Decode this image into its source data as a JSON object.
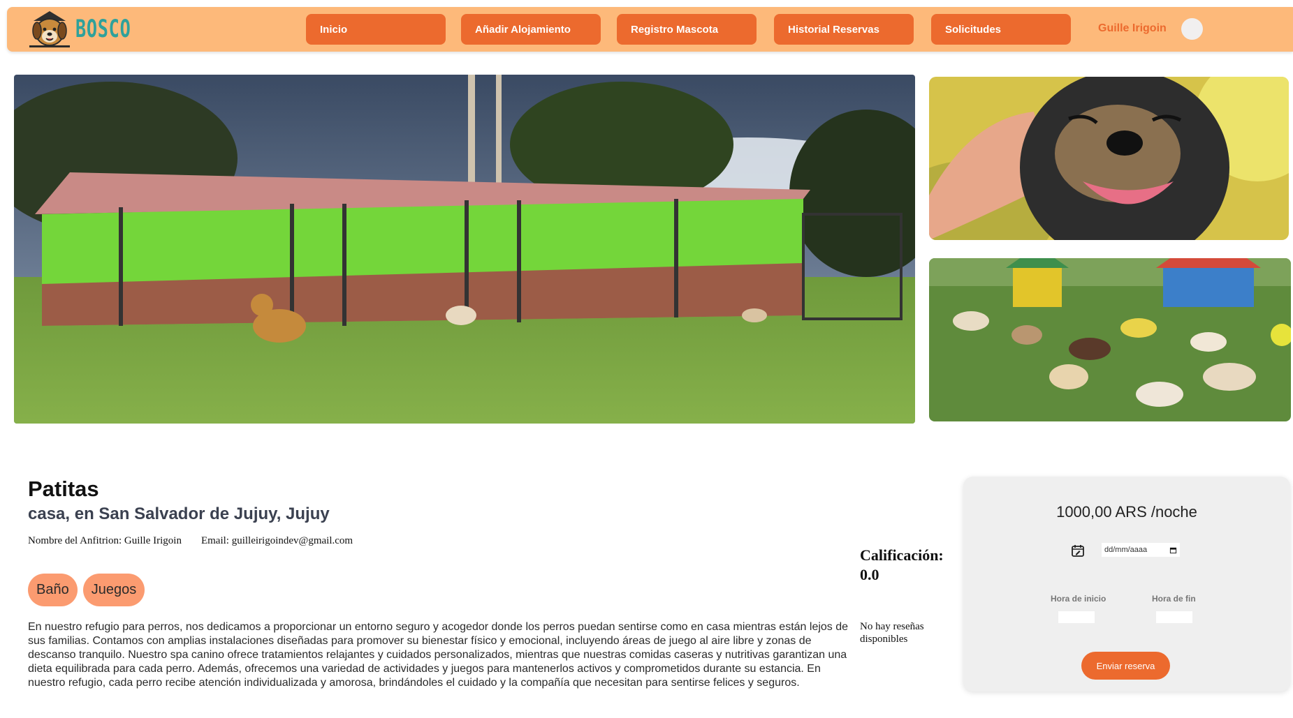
{
  "brand": {
    "name": "BOSCO",
    "logo_icon": "dog-head-logo",
    "accent": "#ec6a2e",
    "nav_bg": "#fdb97a",
    "brand_color": "#2fa19b"
  },
  "nav": {
    "items": [
      {
        "label": "Inicio"
      },
      {
        "label": "Añadir Alojamiento"
      },
      {
        "label": "Registro Mascota"
      },
      {
        "label": "Historial Reservas"
      },
      {
        "label": "Solicitudes"
      }
    ],
    "user_name": "Guille Irigoin"
  },
  "gallery": {
    "main": "dog-kennel-photo",
    "top": "happy-dog-photo",
    "bottom": "dogs-playing-photo"
  },
  "listing": {
    "title": "Patitas",
    "subtitle": "casa, en San Salvador de Jujuy, Jujuy",
    "host": "Nombre del Anfitrion: Guille Irigoin",
    "email": "Email: guilleirigoindev@gmail.com",
    "tags": [
      "Baño",
      "Juegos"
    ],
    "description": "En nuestro refugio para perros, nos dedicamos a proporcionar un entorno seguro y acogedor donde los perros puedan sentirse como en casa mientras están lejos de sus familias. Contamos con amplias instalaciones diseñadas para promover su bienestar físico y emocional, incluyendo áreas de juego al aire libre y zonas de descanso tranquilo. Nuestro spa canino ofrece tratamientos relajantes y cuidados personalizados, mientras que nuestras comidas caseras y nutritivas garantizan una dieta equilibrada para cada perro. Además, ofrecemos una variedad de actividades y juegos para mantenerlos activos y comprometidos durante su estancia. En nuestro refugio, cada perro recibe atención individualizada y amorosa, brindándoles el cuidado y la compañía que necesitan para sentirse felices y seguros."
  },
  "rating": {
    "label": "Calificación:",
    "value": "0.0"
  },
  "reviews": {
    "empty_text": "No hay reseñas disponibles"
  },
  "booking": {
    "price": "1000,00 ARS /noche",
    "date_placeholder": "dd/mm/aaaa",
    "start_label": "Hora de inicio",
    "end_label": "Hora de fin",
    "submit_label": "Enviar reserva"
  }
}
